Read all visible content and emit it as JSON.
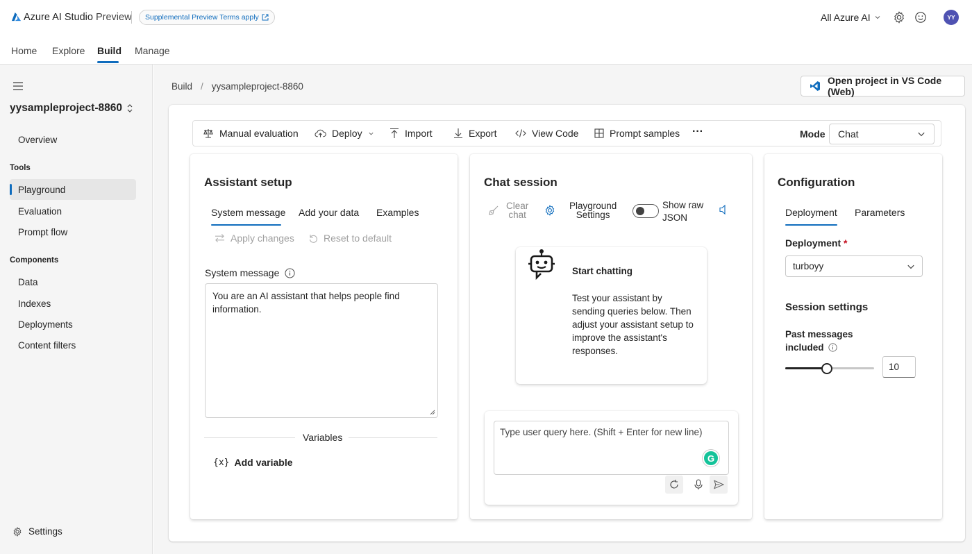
{
  "header": {
    "brand_name": "Azure AI Studio",
    "brand_suffix": "Preview",
    "preview_pill": "Supplemental Preview Terms apply",
    "scope_selector": "All Azure AI",
    "avatar_initials": "YY",
    "nav_tabs": [
      "Home",
      "Explore",
      "Build",
      "Manage"
    ],
    "active_tab": "Build",
    "accent_color": "#0f6cbd"
  },
  "sidebar": {
    "project_name": "yysampleproject-8860",
    "overview": "Overview",
    "tools_heading": "Tools",
    "tools": [
      "Playground",
      "Evaluation",
      "Prompt flow"
    ],
    "active_item": "Playground",
    "components_heading": "Components",
    "components": [
      "Data",
      "Indexes",
      "Deployments",
      "Content filters"
    ],
    "settings": "Settings"
  },
  "main": {
    "breadcrumb": [
      "Build",
      "/",
      "yysampleproject-8860"
    ],
    "vscode_button": "Open project in VS Code (Web)",
    "toolbar": {
      "manual_evaluation": "Manual evaluation",
      "deploy": "Deploy",
      "import": "Import",
      "export": "Export",
      "view_code": "View Code",
      "prompt_samples": "Prompt samples",
      "more": "···",
      "mode_label": "Mode",
      "mode_value": "Chat"
    },
    "assistant_setup": {
      "title": "Assistant setup",
      "tabs": [
        "System message",
        "Add your data",
        "Examples"
      ],
      "apply_changes": "Apply changes",
      "reset_to_default": "Reset to default",
      "system_message_label": "System message",
      "system_message_value": "You are an AI assistant that helps people find information.",
      "variables_label": "Variables",
      "add_variable": "Add variable",
      "variable_icon": "{x}"
    },
    "chat_session": {
      "title": "Chat session",
      "clear_chat_line1": "Clear",
      "clear_chat_line2": "chat",
      "playground_settings_line1": "Playground",
      "playground_settings_line2": "Settings",
      "show_raw_json_line1": "Show raw",
      "show_raw_json_line2": "JSON",
      "start_title": "Start chatting",
      "start_body": "Test your assistant by sending queries below. Then adjust your assistant setup to improve the assistant's responses.",
      "input_placeholder": "Type user query here. (Shift + Enter for new line)",
      "grammarly_letter": "G"
    },
    "configuration": {
      "title": "Configuration",
      "tabs": [
        "Deployment",
        "Parameters"
      ],
      "deployment_label": "Deployment",
      "required_mark": "*",
      "deployment_value": "turboyy",
      "session_settings": "Session settings",
      "past_messages_line1": "Past messages",
      "past_messages_line2": "included",
      "past_messages_value": "10",
      "slider_fraction": 0.47
    }
  }
}
